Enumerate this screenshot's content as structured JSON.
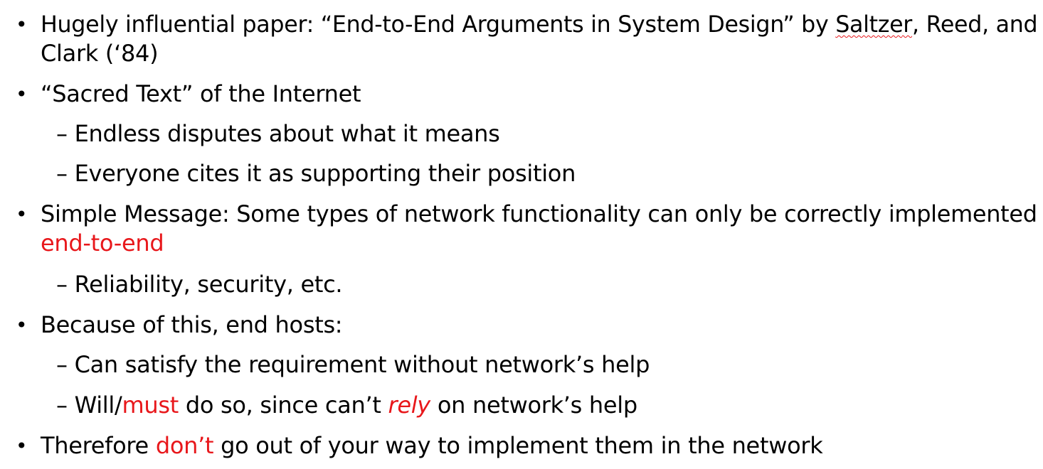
{
  "slide": {
    "bullet_glyph": "•",
    "items": [
      {
        "line1_pre": "Hugely influential paper: “End-to-End Arguments in System Design” by ",
        "line1_author": "Saltzer",
        "line1_post": ", Reed, and",
        "line2": "Clark (‘84)"
      },
      {
        "text": "“Sacred Text” of the Internet"
      },
      {
        "text": "– Endless disputes about what it means"
      },
      {
        "text": "– Everyone cites it as supporting their position"
      },
      {
        "line1": "Simple Message: Some types of network functionality can only be correctly implemented",
        "line2": "end-to-end"
      },
      {
        "text": "– Reliability, security, etc."
      },
      {
        "text": "Because of this, end hosts:"
      },
      {
        "text": "– Can satisfy the requirement without network’s help"
      },
      {
        "pre": "– Will/",
        "red": "must",
        "mid": " do so, since can’t ",
        "italic_red": "rely",
        "post": " on network’s help"
      },
      {
        "pre": "Therefore ",
        "red": "don’t",
        "post": " go out of your way to implement them in the network"
      }
    ]
  },
  "colors": {
    "text": "#000000",
    "accent_red": "#e8171b",
    "background": "#ffffff"
  }
}
